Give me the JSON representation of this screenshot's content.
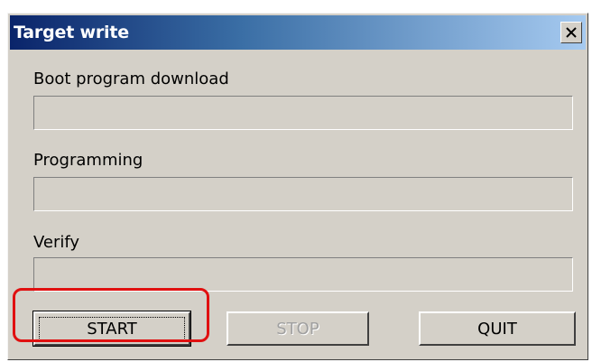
{
  "window": {
    "title": "Target write",
    "close_label": "×"
  },
  "sections": [
    {
      "label": "Boot program download",
      "progress": 0
    },
    {
      "label": "Programming",
      "progress": 0
    },
    {
      "label": "Verify",
      "progress": 0
    }
  ],
  "buttons": {
    "start": "START",
    "stop": "STOP",
    "quit": "QUIT"
  },
  "colors": {
    "highlight": "#e01010",
    "titlebar_start": "#0a246a",
    "titlebar_end": "#a6caf0"
  }
}
